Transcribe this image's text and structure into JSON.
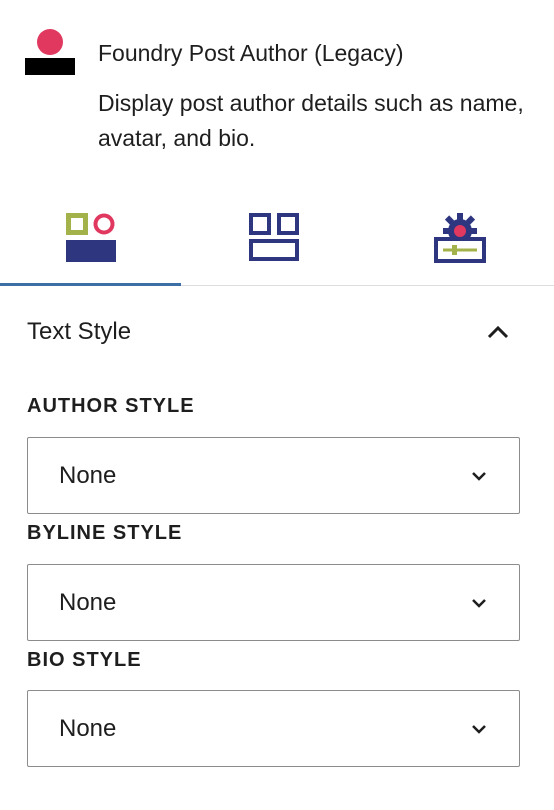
{
  "block": {
    "title": "Foundry Post Author (Legacy)",
    "description": "Display post author details such as name, avatar, and bio.",
    "icon": "block-logo-icon",
    "colors": {
      "accent_red": "#e0385f",
      "dark": "#000000",
      "navy": "#2e3680",
      "green": "#a3b24a",
      "tab_underline": "#3b6fa5"
    }
  },
  "tabs": [
    {
      "name": "style-tab",
      "icon": "style-icon",
      "active": true
    },
    {
      "name": "layout-tab",
      "icon": "layout-grid-icon",
      "active": false
    },
    {
      "name": "settings-tab",
      "icon": "gear-settings-icon",
      "active": false
    }
  ],
  "panel": {
    "title": "Text Style",
    "expanded": true,
    "fields": [
      {
        "label": "AUTHOR STYLE",
        "value": "None"
      },
      {
        "label": "BYLINE STYLE",
        "value": "None"
      },
      {
        "label": "BIO STYLE",
        "value": "None"
      }
    ]
  }
}
